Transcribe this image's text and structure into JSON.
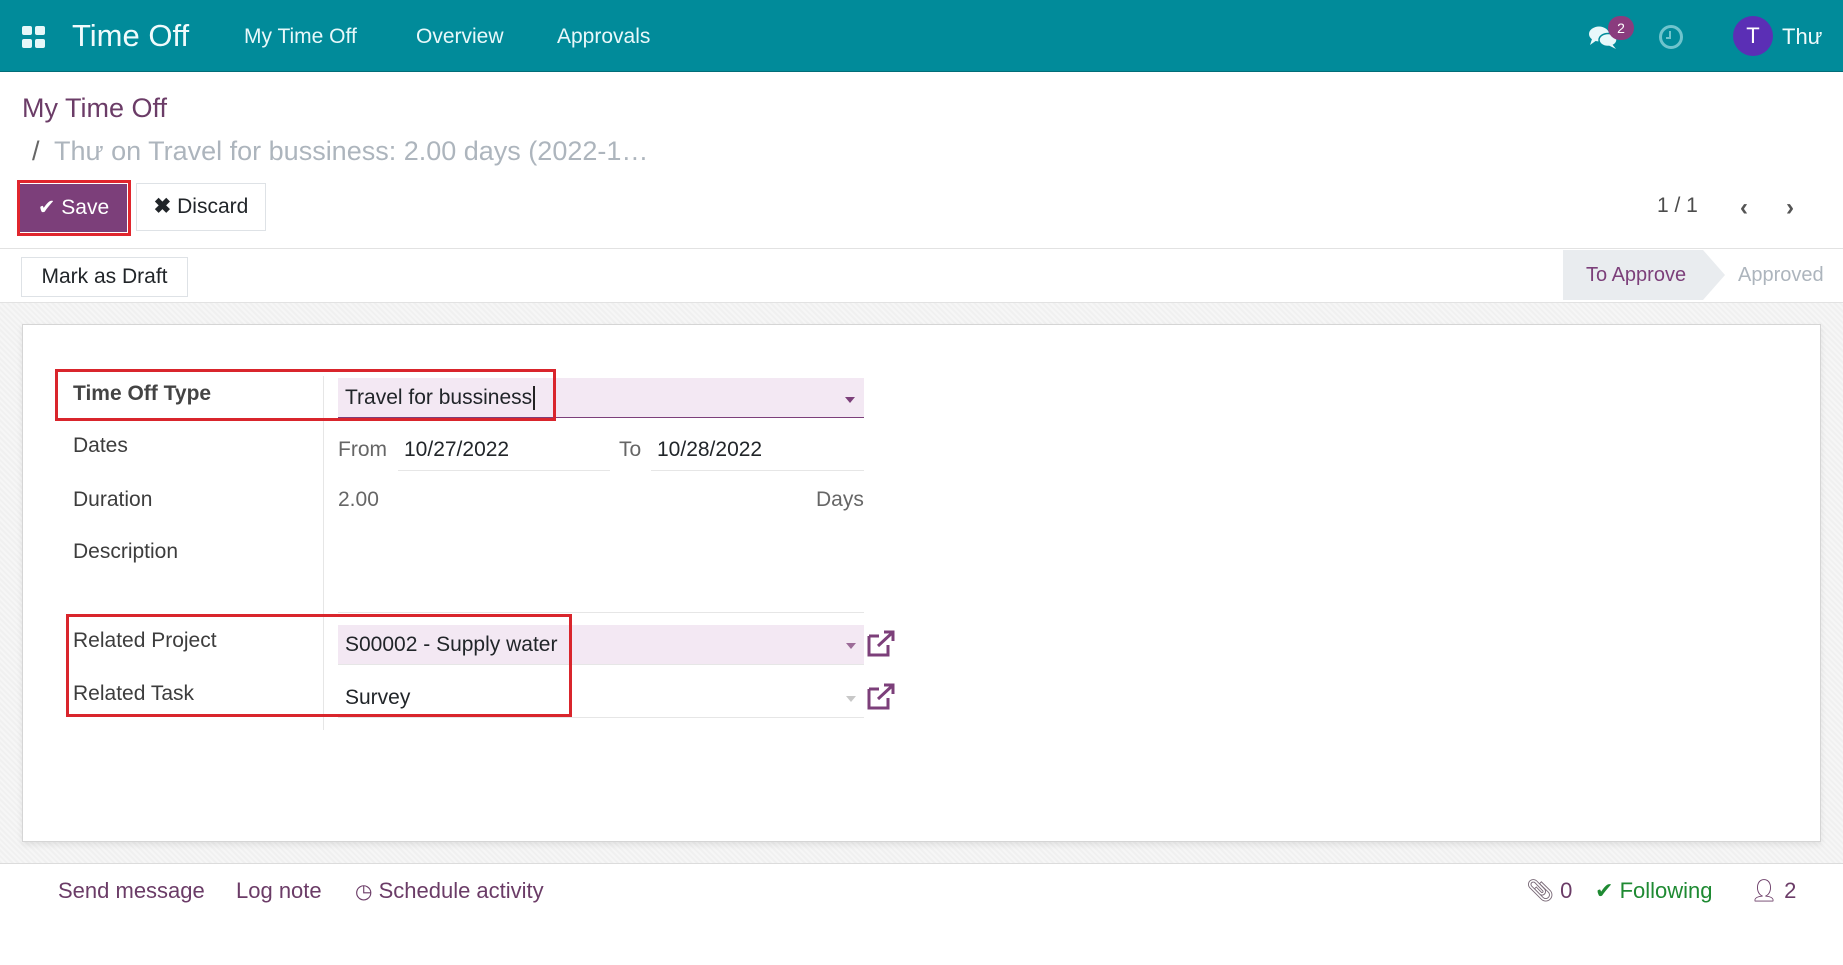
{
  "navbar": {
    "app_icon": "apps-grid-icon",
    "brand": "Time Off",
    "menu": [
      "My Time Off",
      "Overview",
      "Approvals"
    ],
    "messages_icon": "chat-bubbles-icon",
    "messages_count": "2",
    "activity_icon": "clock-icon",
    "user_initial": "T",
    "user_name": "Thư",
    "avatar_color": "#5b2fb5"
  },
  "breadcrumb": {
    "parent": "My Time Off",
    "separator": "/",
    "current": "Thư on Travel for bussiness: 2.00 days (2022-1…"
  },
  "control_panel": {
    "save_label": "Save",
    "discard_label": "Discard",
    "pager": "1 / 1",
    "prev_icon": "chevron-left-icon",
    "next_icon": "chevron-right-icon"
  },
  "statusbar": {
    "draft_button": "Mark as Draft",
    "stages": [
      {
        "label": "To Approve",
        "active": true
      },
      {
        "label": "Approved",
        "active": false
      }
    ]
  },
  "form": {
    "time_off_type": {
      "label": "Time Off Type",
      "value": "Travel for bussiness"
    },
    "dates": {
      "label": "Dates",
      "from_label": "From",
      "from": "10/27/2022",
      "to_label": "To",
      "to": "10/28/2022"
    },
    "duration": {
      "label": "Duration",
      "value": "2.00",
      "unit": "Days"
    },
    "description": {
      "label": "Description",
      "value": ""
    },
    "related_project": {
      "label": "Related Project",
      "value": "S00002 - Supply water"
    },
    "related_task": {
      "label": "Related Task",
      "value": "Survey"
    }
  },
  "chatter": {
    "send_message": "Send message",
    "log_note": "Log note",
    "schedule_activity": "Schedule activity",
    "attachments_count": "0",
    "following": "Following",
    "followers_count": "2"
  },
  "colors": {
    "navbar": "#018b9a",
    "primary": "#7c3f7a",
    "highlight": "#e0262e",
    "following": "#28a745"
  }
}
